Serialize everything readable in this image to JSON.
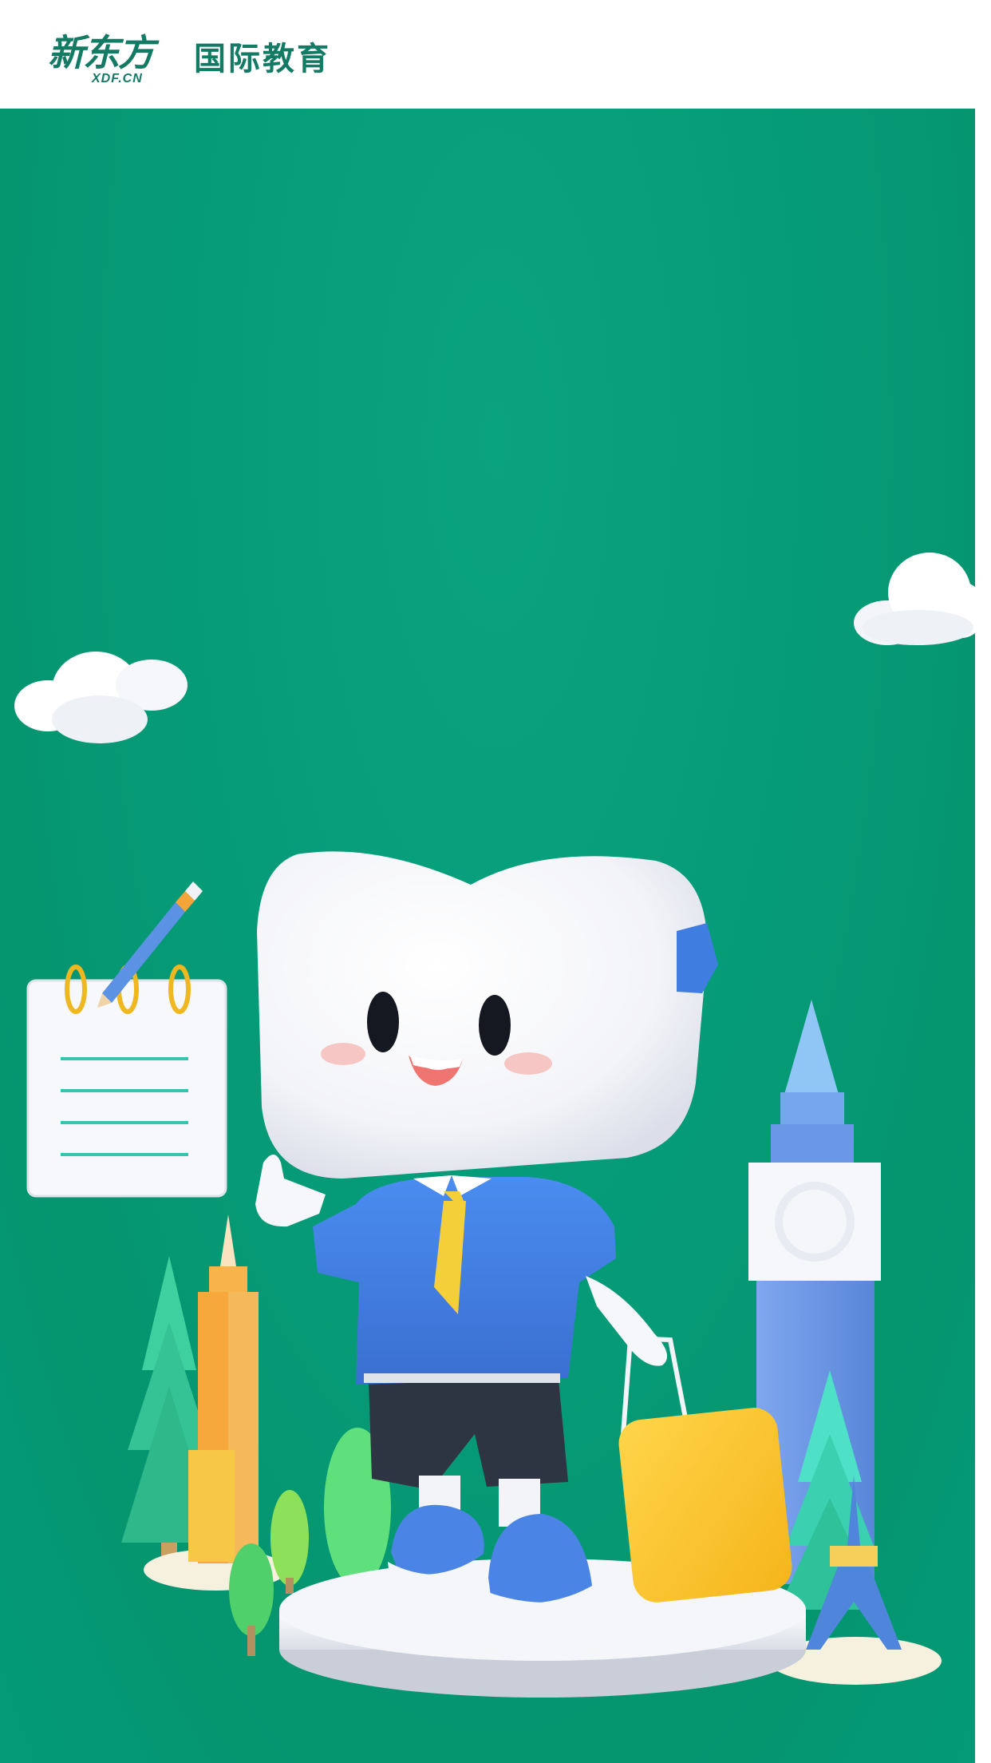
{
  "header": {
    "logo_cn": "新东方",
    "logo_url": "XDF.CN",
    "division": "国际教育"
  },
  "colors": {
    "brand_green": "#137a63",
    "background_green": "#069c79",
    "mascot_shirt": "#3f7ee0",
    "tie_yellow": "#f5cf3a",
    "suitcase_yellow": "#fbc52a",
    "tower_blue": "#6b98e6"
  },
  "illustration": {
    "icons": [
      "cloud-icon",
      "notepad-icon",
      "pencil-icon",
      "mascot-icon",
      "suitcase-icon",
      "clock-tower-icon",
      "eiffel-tower-icon",
      "skyscraper-icon",
      "tree-icon"
    ]
  }
}
